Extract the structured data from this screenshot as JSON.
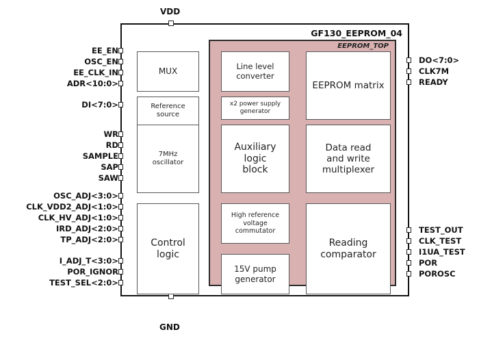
{
  "power": {
    "vdd": "VDD",
    "gnd": "GND"
  },
  "chip": {
    "title": "GF130_EEPROM_04"
  },
  "eeprom_top": {
    "title": "EEPROM_TOP"
  },
  "outer_blocks": {
    "mux": "MUX",
    "reference_source": "Reference\nsource",
    "oscillator": "7MHz\noscillator",
    "control_logic": "Control\nlogic"
  },
  "inner_blocks": {
    "line_level_converter": "Line level\nconverter",
    "eeprom_matrix": "EEPROM matrix",
    "power_supply_generator": "x2 power supply\ngenerator",
    "auxiliary_logic_block": "Auxiliary\nlogic\nblock",
    "data_rw_multiplexer": "Data read\nand write\nmultiplexer",
    "high_ref_voltage_commutator": "High reference\nvoltage\ncommutator",
    "reading_comparator": "Reading\ncomparator",
    "pump_generator": "15V pump\ngenerator"
  },
  "left_pins": [
    "EE_EN",
    "OSC_EN",
    "EE_CLK_IN",
    "ADR<10:0>",
    "DI<7:0>",
    "WR",
    "RD",
    "SAMPLE",
    "SAP",
    "SAW",
    "OSC_ADJ<3:0>",
    "CLK_VDD2_ADJ<1:0>",
    "CLK_HV_ADJ<1:0>",
    "IRD_ADJ<2:0>",
    "TP_ADJ<2:0>",
    "I_ADJ_T<3:0>",
    "POR_IGNOR",
    "TEST_SEL<2:0>"
  ],
  "right_pins": [
    "DO<7:0>",
    "CLK7M",
    "READY",
    "TEST_OUT",
    "CLK_TEST",
    "I1UA_TEST",
    "POR",
    "POROSC"
  ]
}
